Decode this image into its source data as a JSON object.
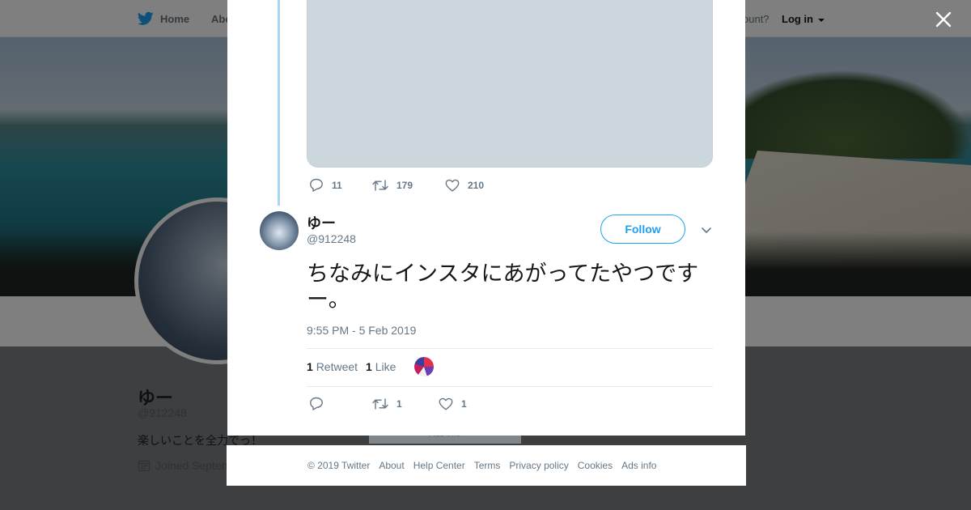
{
  "topnav": {
    "home_label": "Home",
    "about_label": "Abo",
    "account_prompt": "ccount?",
    "login_label": "Log in"
  },
  "profile": {
    "name": "ゆー",
    "handle": "@912248",
    "bio": "楽しいことを全力でっ！",
    "joined": "Joined Septem",
    "ads_info": "Ads info"
  },
  "previous_tweet": {
    "replies": "11",
    "retweets": "179",
    "likes": "210"
  },
  "tweet": {
    "name": "ゆー",
    "handle": "@912248",
    "follow_label": "Follow",
    "text": "ちなみにインスタにあがってたやつですー。",
    "timestamp": "9:55 PM - 5 Feb 2019",
    "retweet_count": "1",
    "retweet_label": "Retweet",
    "like_count": "1",
    "like_label": "Like",
    "action_retweets": "1",
    "action_likes": "1"
  },
  "footer": {
    "copyright": "© 2019 Twitter",
    "links": [
      "About",
      "Help Center",
      "Terms",
      "Privacy policy",
      "Cookies",
      "Ads info"
    ]
  },
  "colors": {
    "twitter_blue": "#1da1f2",
    "thread_line": "#a8d7f4",
    "muted_text": "#657786",
    "media_placeholder": "#ccd6dd"
  },
  "icons": [
    "twitter-bird-icon",
    "caret-down-icon",
    "close-icon",
    "calendar-icon",
    "reply-icon",
    "retweet-icon",
    "heart-icon",
    "chevron-down-icon"
  ]
}
